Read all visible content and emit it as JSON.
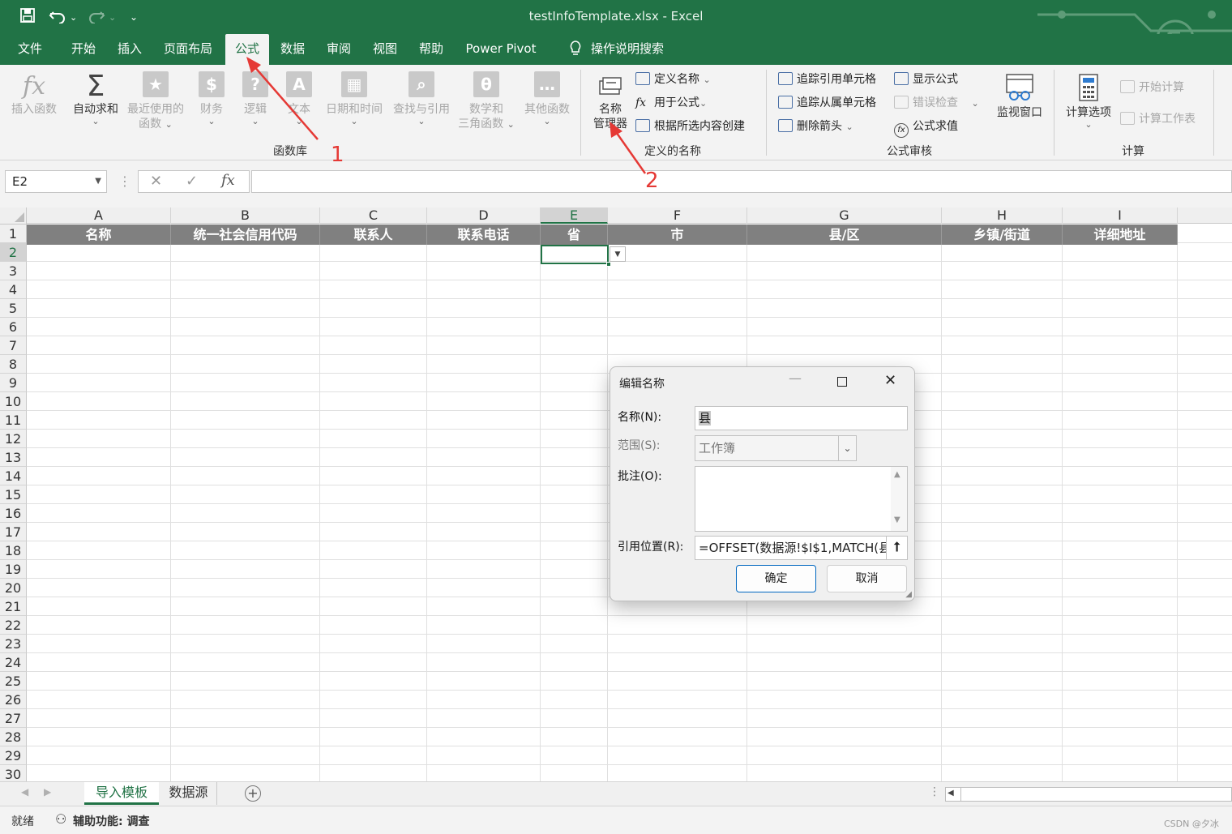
{
  "window": {
    "title": "testInfoTemplate.xlsx  -  Excel"
  },
  "ribbon_tabs": [
    "文件",
    "开始",
    "插入",
    "页面布局",
    "公式",
    "数据",
    "审阅",
    "视图",
    "帮助",
    "Power Pivot"
  ],
  "active_tab": "公式",
  "tell_me": "操作说明搜索",
  "function_library": {
    "insert_function": "插入函数",
    "autosum": "自动求和",
    "recent": [
      "最近使用的",
      "函数"
    ],
    "financial": "财务",
    "logical": "逻辑",
    "text": "文本",
    "datetime": "日期和时间",
    "lookup": "查找与引用",
    "math": [
      "数学和",
      "三角函数"
    ],
    "more": "其他函数",
    "group_label": "函数库"
  },
  "defined_names": {
    "name_manager": [
      "名称",
      "管理器"
    ],
    "define_name": "定义名称",
    "use_in_formula": "用于公式",
    "create_from_selection": "根据所选内容创建",
    "group_label": "定义的名称"
  },
  "formula_auditing": {
    "trace_precedents": "追踪引用单元格",
    "trace_dependents": "追踪从属单元格",
    "remove_arrows": "删除箭头",
    "show_formulas": "显示公式",
    "error_checking": "错误检查",
    "evaluate_formula": "公式求值",
    "watch_window": "监视窗口",
    "group_label": "公式审核"
  },
  "calculation": {
    "calc_options": "计算选项",
    "calc_now": "开始计算",
    "calc_sheet": "计算工作表",
    "group_label": "计算"
  },
  "formula_bar": {
    "name_box": "E2",
    "fx": "fx",
    "formula": ""
  },
  "columns": [
    "A",
    "B",
    "C",
    "D",
    "E",
    "F",
    "G",
    "H",
    "I"
  ],
  "selected_column": "E",
  "selected_row": "2",
  "header_row": [
    "名称",
    "统一社会信用代码",
    "联系人",
    "联系电话",
    "省",
    "市",
    "县/区",
    "乡镇/街道",
    "详细地址"
  ],
  "rows": [
    "1",
    "2",
    "3",
    "4",
    "5",
    "6",
    "7",
    "8",
    "9",
    "10",
    "11",
    "12",
    "13",
    "14",
    "15",
    "16",
    "17",
    "18",
    "19",
    "20",
    "21",
    "22",
    "23",
    "24",
    "25",
    "26",
    "27",
    "28",
    "29",
    "30"
  ],
  "sheets": [
    "导入模板",
    "数据源"
  ],
  "active_sheet": "导入模板",
  "status": {
    "ready": "就绪",
    "accessibility": "辅助功能: 调查",
    "watermark": "CSDN @夕冰"
  },
  "dialog": {
    "title": "编辑名称",
    "name_label": "名称(N):",
    "name_value": "县",
    "scope_label": "范围(S):",
    "scope_value": "工作簿",
    "comment_label": "批注(O):",
    "comment_value": "",
    "refers_label": "引用位置(R):",
    "refers_value": "=OFFSET(数据源!$I$1,MATCH(县",
    "ok": "确定",
    "cancel": "取消"
  },
  "annotations": [
    "1",
    "2"
  ],
  "colors": {
    "excel_green": "#217346",
    "header_fill": "#808080",
    "annotation_red": "#e53935"
  }
}
